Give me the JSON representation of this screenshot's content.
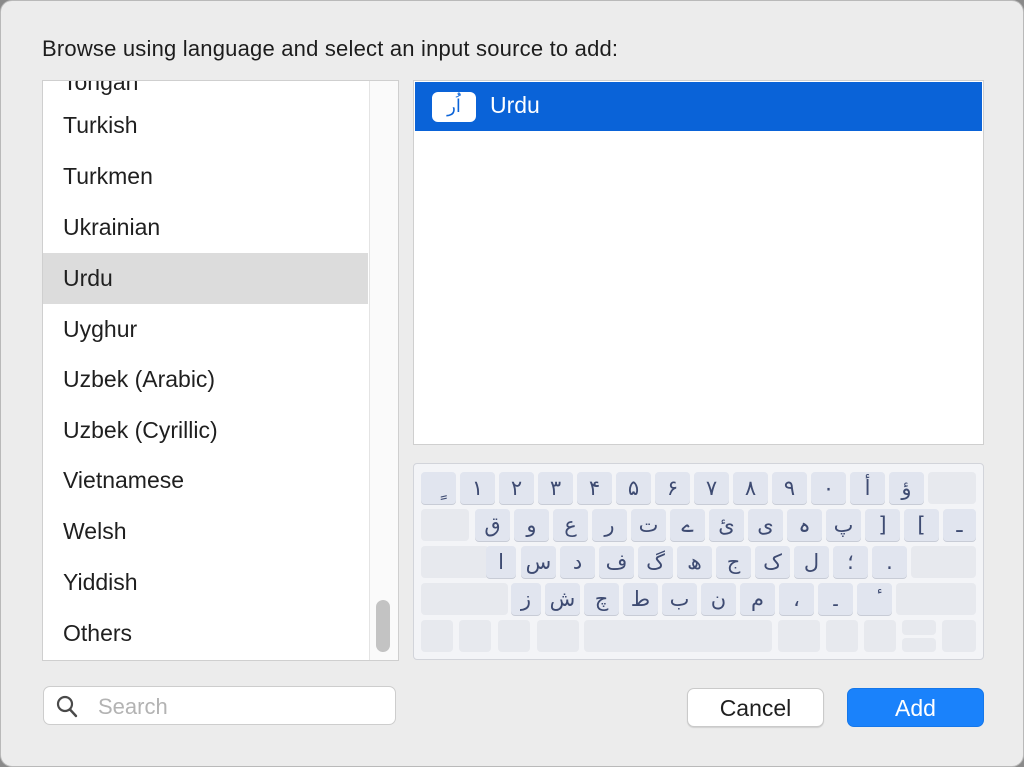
{
  "dialog": {
    "prompt": "Browse using language and select an input source to add:"
  },
  "languages": {
    "partial_top": "Tongan",
    "items": [
      "Turkish",
      "Turkmen",
      "Ukrainian",
      "Urdu",
      "Uyghur",
      "Uzbek (Arabic)",
      "Uzbek (Cyrillic)",
      "Vietnamese",
      "Welsh",
      "Yiddish",
      "Others"
    ],
    "selected": "Urdu"
  },
  "sources": {
    "items": [
      {
        "icon_text": "اُر",
        "label": "Urdu",
        "selected": true
      }
    ]
  },
  "keyboard": {
    "row1": [
      "ٍ",
      "۱",
      "۲",
      "۳",
      "۴",
      "۵",
      "۶",
      "۷",
      "۸",
      "۹",
      "۰",
      "أ",
      "ؤ",
      ""
    ],
    "row2": [
      "",
      "ق",
      "و",
      "ع",
      "ر",
      "ت",
      "ے",
      "ئ",
      "ی",
      "ہ",
      "پ",
      "]",
      "[",
      "ـ"
    ],
    "row3": [
      "",
      "ا",
      "س",
      "د",
      "ف",
      "گ",
      "ھ",
      "ج",
      "ک",
      "ل",
      "؛",
      ".",
      ""
    ],
    "row4": [
      "",
      "ز",
      "ش",
      "چ",
      "ط",
      "ب",
      "ن",
      "م",
      "،",
      "۔",
      "ٔ",
      ""
    ],
    "row5": [
      "",
      "",
      "",
      "",
      "",
      "",
      "",
      "",
      "",
      ""
    ]
  },
  "search": {
    "placeholder": "Search",
    "value": ""
  },
  "buttons": {
    "cancel": "Cancel",
    "add": "Add"
  },
  "colors": {
    "selection_blue": "#0a63d8",
    "add_button": "#1a82fb",
    "list_selected": "#dcdcdc",
    "key_text": "#3e4b72"
  }
}
